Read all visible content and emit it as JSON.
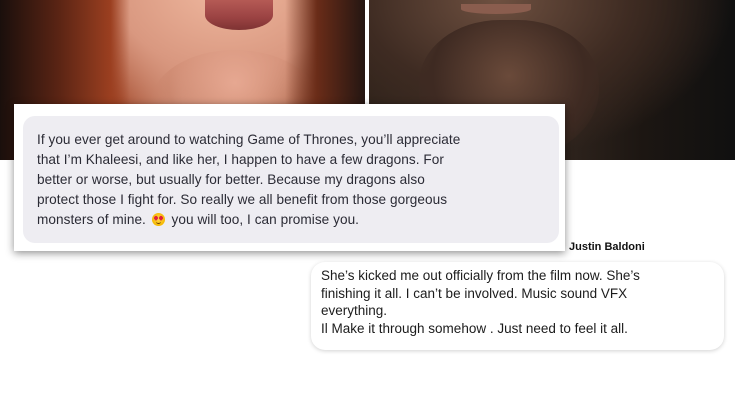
{
  "messages": {
    "left": {
      "lines": [
        "If you ever get around to watching Game of Thrones, you’ll appreciate",
        "that I’m Khaleesi, and like her, I happen to have a few dragons. For",
        "better or worse, but usually for better. Because my dragons also",
        "protect those I fight for. So really we all benefit from those gorgeous",
        "monsters of mine.",
        "you will too, I can promise you."
      ],
      "emoji": "smiling-face-with-heart-eyes-icon"
    },
    "right": {
      "sender": "Justin Baldoni",
      "lines": [
        "She’s kicked me out officially from the film now. She’s",
        "finishing it all. I can’t be involved. Music sound VFX",
        "everything.",
        "Il Make it through somehow . Just need to feel it all."
      ]
    }
  },
  "colors": {
    "left_bubble": "#eeedf2",
    "right_bubble": "#ffffff",
    "text": "#2b2b35"
  }
}
